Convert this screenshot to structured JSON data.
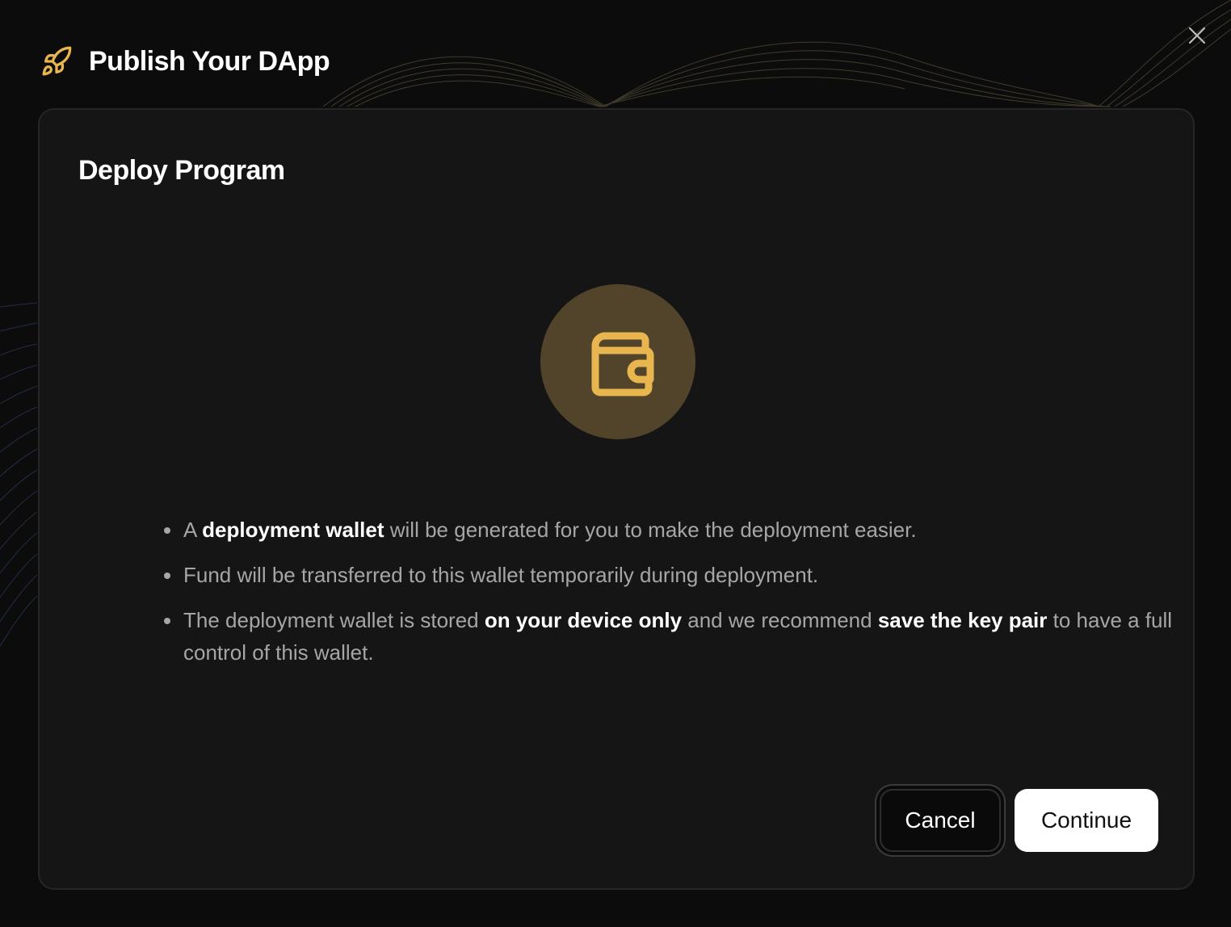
{
  "header": {
    "title": "Publish Your DApp",
    "icon": "rocket-icon"
  },
  "close": {
    "icon": "close-icon"
  },
  "card": {
    "title": "Deploy Program",
    "icon": "wallet-icon",
    "bullets": [
      {
        "pre": "A ",
        "bold": "deployment wallet",
        "post": " will be generated for you to make the deployment easier."
      },
      {
        "text": "Fund will be transferred to this wallet temporarily during deployment."
      },
      {
        "pre": "The deployment wallet is stored ",
        "bold1": "on your device only",
        "mid": " and we recommend ",
        "bold2": "save the key pair",
        "post": " to have a full control of this wallet."
      }
    ]
  },
  "actions": {
    "cancel_label": "Cancel",
    "continue_label": "Continue"
  },
  "colors": {
    "accent": "#e8b54f",
    "icon_circle": "#51442a",
    "background": "#0c0c0c",
    "card": "#151515"
  }
}
